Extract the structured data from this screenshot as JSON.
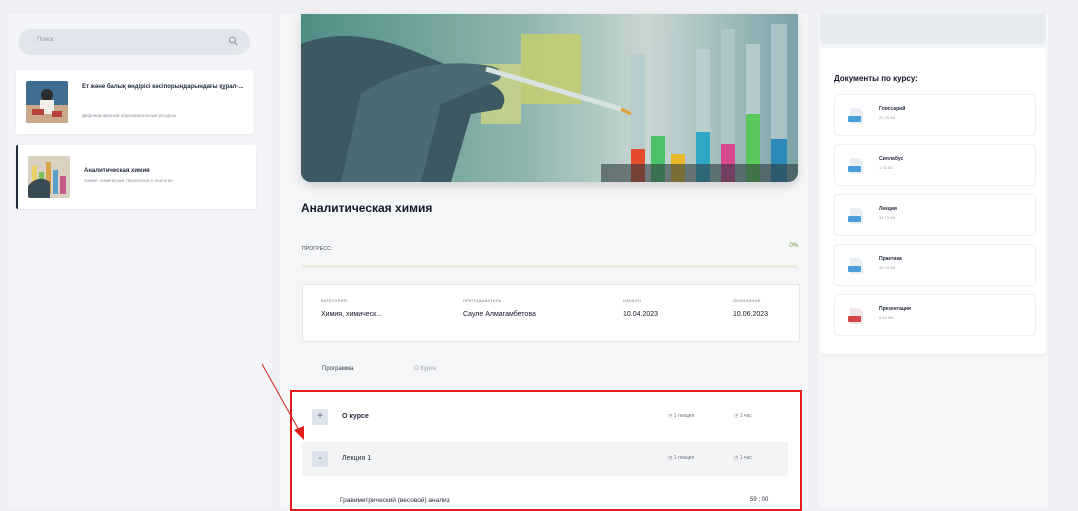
{
  "sidebar": {
    "search_placeholder": "Поиск",
    "courses": [
      {
        "title": "Ет және балық өндірісі кәсіпорындарындағы құрал-...",
        "subtitle": "Дефинированный образовательные ресурсы"
      },
      {
        "title": "Аналитическая химия",
        "subtitle": "Химия, химические технологии и экология"
      }
    ]
  },
  "course": {
    "title": "Аналитическая химия",
    "progress_label": "ПРОГРЕСС:",
    "progress_percent": "0%",
    "progress_value": 0.0,
    "info": [
      {
        "key": "КАТЕГОРИЯ",
        "value": "Химия, химическ..."
      },
      {
        "key": "ПРЕПОДАВАТЕЛЬ",
        "value": "Сауле Алмагамбетова"
      },
      {
        "key": "НАЧАЛО",
        "value": "10.04.2023"
      },
      {
        "key": "ОКОНЧАНИЕ",
        "value": "10.06.2023"
      }
    ],
    "tabs": [
      "Программа",
      "О Курсе"
    ]
  },
  "program": {
    "rows": [
      {
        "toggle": "+",
        "title": "О курсе",
        "lectures": "1 лекция",
        "hours": "1 час"
      },
      {
        "toggle": "-",
        "title": "Лекция 1",
        "lectures": "1 лекция",
        "hours": "1 час"
      }
    ],
    "lesson": {
      "title": "Гравиметрический (весовой) анализ",
      "duration": "59 : 00"
    }
  },
  "documents": {
    "title": "Документы по курсу:",
    "items": [
      {
        "name": "Глоссарий",
        "size": "21.29 КБ",
        "color": "#4a9fd8"
      },
      {
        "name": "Силлабус",
        "size": "1.33 КБ",
        "color": "#4a9fd8"
      },
      {
        "name": "Лекция",
        "size": "34.73 КБ",
        "color": "#4a9fd8"
      },
      {
        "name": "Практика",
        "size": "36.43 КБ",
        "color": "#4a9fd8"
      },
      {
        "name": "Презентация",
        "size": "8.53 МБ",
        "color": "#d64545"
      }
    ]
  },
  "colors": {
    "highlight": "#e11d1d",
    "accent": "#9cc46b"
  }
}
